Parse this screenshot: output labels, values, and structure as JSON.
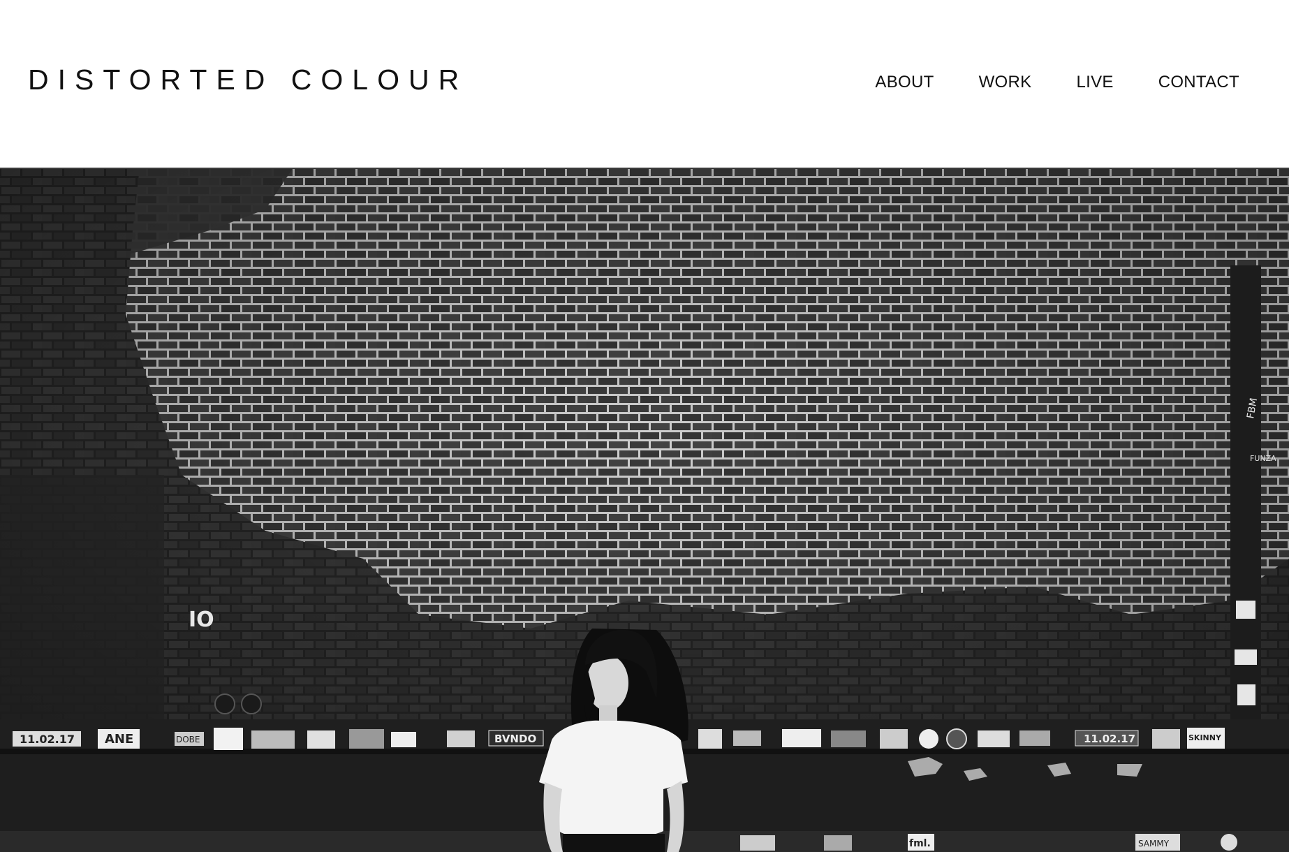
{
  "site": {
    "title": "DISTORTED COLOUR"
  },
  "nav": {
    "items": [
      {
        "label": "ABOUT"
      },
      {
        "label": "WORK"
      },
      {
        "label": "LIVE"
      },
      {
        "label": "CONTACT"
      }
    ]
  },
  "hero": {
    "wall_tag": "IO",
    "sticker_text": [
      "11.02.17",
      "BVNDO",
      "DOBE",
      "11.02.17",
      "fml.",
      "SKINNY",
      "ANE",
      "FBM",
      "FUNZA",
      "SAMMY"
    ]
  }
}
